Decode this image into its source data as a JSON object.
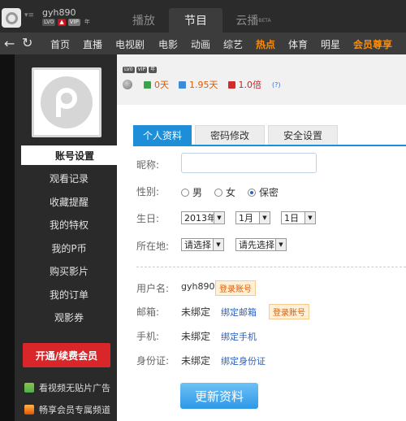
{
  "titlebar": {
    "username": "gyh890",
    "badges": [
      "LV0",
      "VIP",
      "年"
    ],
    "tabs": [
      {
        "label": "播放",
        "active": false
      },
      {
        "label": "节目",
        "active": true
      },
      {
        "label": "云播",
        "active": false,
        "suffix": "BETA"
      }
    ]
  },
  "nav": {
    "items": [
      "首页",
      "直播",
      "电视剧",
      "电影",
      "动画",
      "综艺",
      "热点",
      "体育",
      "明星",
      "会员尊享"
    ]
  },
  "sidebar": {
    "items": [
      "账号设置",
      "观看记录",
      "收藏提醒",
      "我的特权",
      "我的P币",
      "购买影片",
      "我的订单",
      "观影券"
    ],
    "vip_button": "开通/续费会员",
    "promos": [
      "看视频无贴片广告",
      "畅享会员专属频道"
    ]
  },
  "profile_top": {
    "badges": [
      "LV0",
      "VIP",
      "年"
    ],
    "days_green": "0天",
    "days_blue": "1.95天",
    "multiplier": "1.0倍",
    "question": "(?)"
  },
  "tabs": [
    "个人资料",
    "密码修改",
    "安全设置"
  ],
  "form": {
    "nickname_label": "昵称:",
    "nickname_value": "",
    "gender_label": "性别:",
    "gender_options": [
      "男",
      "女",
      "保密"
    ],
    "gender_selected": "保密",
    "birthday_label": "生日:",
    "birthday_year": "2013年",
    "birthday_month": "1月",
    "birthday_day": "1日",
    "location_label": "所在地:",
    "location_province": "请选择",
    "location_city": "请先选择",
    "username_label": "用户名:",
    "username_value": "gyh890",
    "username_tag": "登录账号",
    "email_label": "邮箱:",
    "email_value": "未绑定",
    "email_link": "绑定邮箱",
    "email_tag": "登录账号",
    "phone_label": "手机:",
    "phone_value": "未绑定",
    "phone_link": "绑定手机",
    "id_label": "身份证:",
    "id_value": "未绑定",
    "id_link": "绑定身份证",
    "submit_label": "更新资料"
  },
  "colors": {
    "accent": "#1e8ed8",
    "vip_red": "#d8262a",
    "hot_orange": "#ff8a00"
  }
}
